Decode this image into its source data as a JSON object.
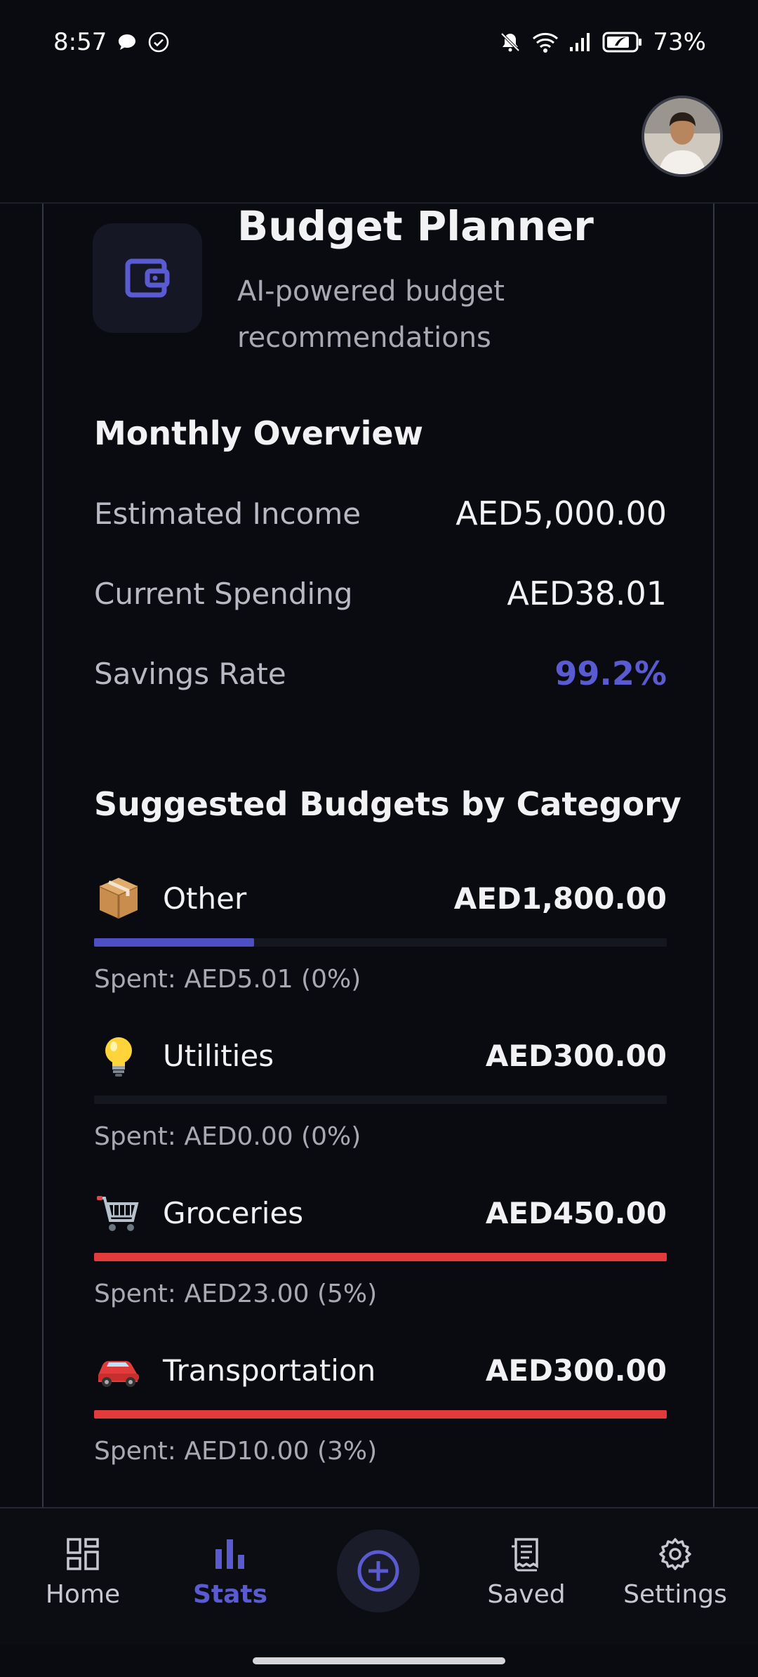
{
  "status_bar": {
    "time": "8:57",
    "battery": "73%"
  },
  "header": {
    "avatar_alt": "profile photo"
  },
  "page": {
    "title": "Budget Planner",
    "subtitle": "AI-powered budget recommendations"
  },
  "overview": {
    "title": "Monthly Overview",
    "rows": [
      {
        "label": "Estimated Income",
        "value": "AED5,000.00"
      },
      {
        "label": "Current Spending",
        "value": "AED38.01"
      },
      {
        "label": "Savings Rate",
        "value": "99.2%"
      }
    ]
  },
  "categories_section": {
    "title": "Suggested Budgets by Category",
    "items": [
      {
        "name": "Other",
        "emoji": "📦",
        "amount": "AED1,800.00",
        "spent": "Spent: AED5.01 (0%)",
        "progress": 0.28,
        "bar_color": "#4f4fc4"
      },
      {
        "name": "Utilities",
        "emoji": "💡",
        "amount": "AED300.00",
        "spent": "Spent: AED0.00 (0%)",
        "progress": 0,
        "bar_color": "#4f4fc4"
      },
      {
        "name": "Groceries",
        "emoji": "🛒",
        "amount": "AED450.00",
        "spent": "Spent: AED23.00 (5%)",
        "progress": 1,
        "bar_color": "#e23b3b"
      },
      {
        "name": "Transportation",
        "emoji": "🚗",
        "amount": "AED300.00",
        "spent": "Spent: AED10.00 (3%)",
        "progress": 1,
        "bar_color": "#e23b3b"
      }
    ]
  },
  "nav": {
    "home": "Home",
    "stats": "Stats",
    "saved": "Saved",
    "settings": "Settings"
  },
  "colors": {
    "accent": "#5a5bd1",
    "danger": "#e23b3b",
    "background": "#0a0b10"
  }
}
